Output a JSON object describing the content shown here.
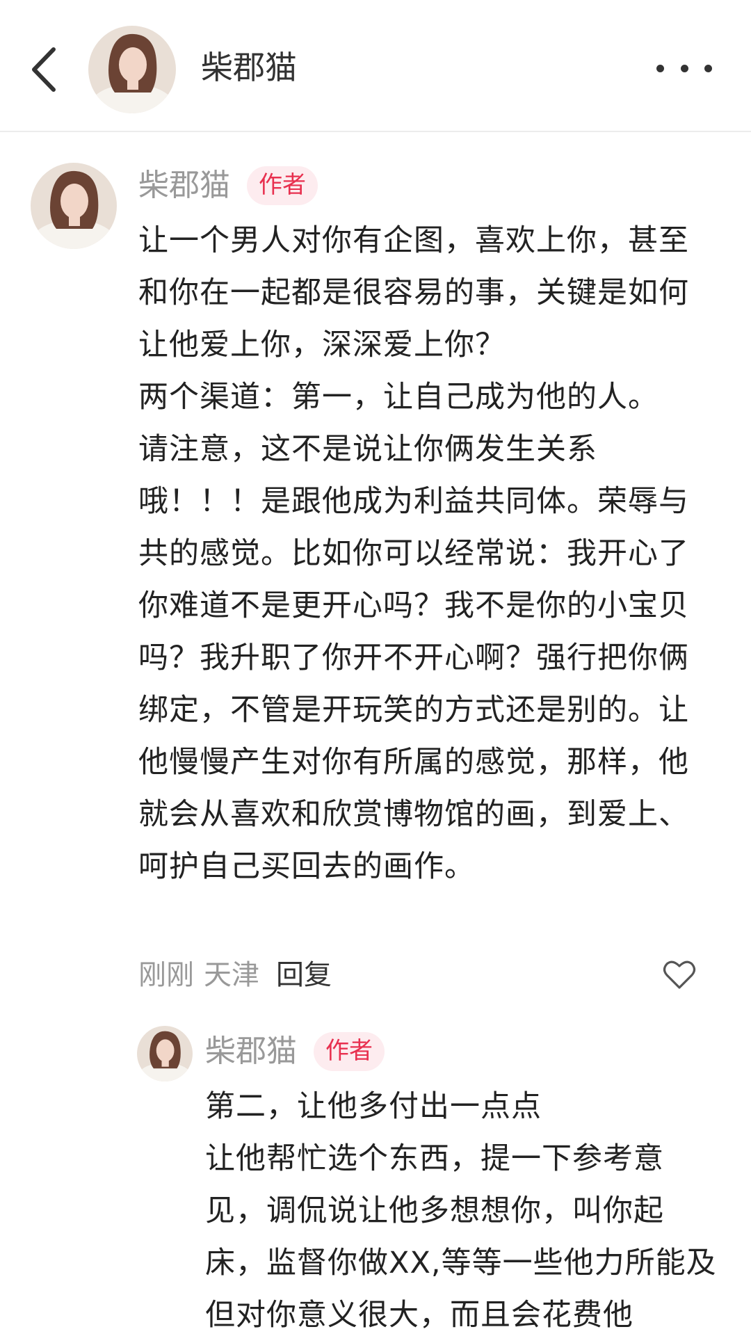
{
  "header": {
    "title": "柴郡猫"
  },
  "comment": {
    "author": "柴郡猫",
    "badge": "作者",
    "text": "让一个男人对你有企图，喜欢上你，甚至和你在一起都是很容易的事，关键是如何让他爱上你，深深爱上你？\n两个渠道：第一，让自己成为他的人。\n请注意，这不是说让你俩发生关系\n哦！！！是跟他成为利益共同体。荣辱与共的感觉。比如你可以经常说：我开心了你难道不是更开心吗？我不是你的小宝贝吗？我升职了你开不开心啊？强行把你俩绑定，不管是开玩笑的方式还是别的。让他慢慢产生对你有所属的感觉，那样，他就会从喜欢和欣赏博物馆的画，到爱上、呵护自己买回去的画作。",
    "time": "刚刚",
    "location": "天津",
    "reply_label": "回复"
  },
  "reply": {
    "author": "柴郡猫",
    "badge": "作者",
    "text": "第二，让他多付出一点点\n让他帮忙选个东西，提一下参考意见，调侃说让他多想想你，叫你起床，监督你做XX,等等一些他力所能及但对你意义很大，而且会花费他"
  },
  "colors": {
    "badge_bg": "#fdecef",
    "badge_text": "#e8304f",
    "muted_text": "#999999",
    "body_text": "#222222"
  },
  "icons": {
    "back": "chevron-left-icon",
    "more": "more-horizontal-icon",
    "like": "heart-outline-icon"
  }
}
